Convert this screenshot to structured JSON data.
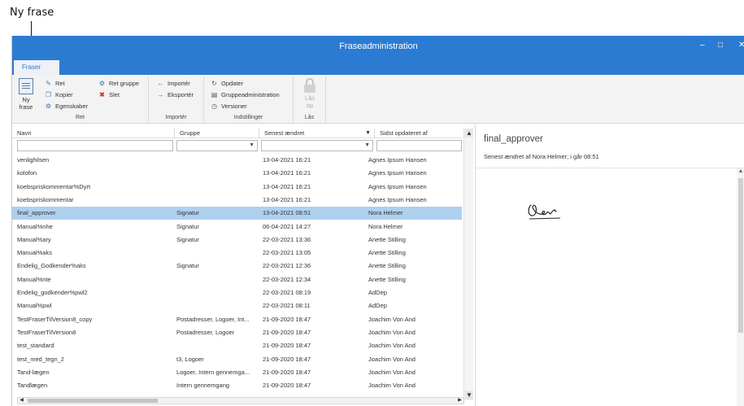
{
  "callout": {
    "label": "Ny frase"
  },
  "window": {
    "title": "Fraseadministration",
    "minimize": "–",
    "maximize": "□",
    "close": "✕"
  },
  "ribbon": {
    "tab": "Fraser",
    "groups": {
      "ret": {
        "label": "Ret",
        "ny_frase": "Ny\nfrase",
        "ret": "Ret",
        "kopier": "Kopier",
        "egenskaber": "Egenskaber",
        "ret_gruppe": "Ret gruppe",
        "slet": "Slet"
      },
      "importer": {
        "label": "Importér",
        "importer": "Importér",
        "eksporter": "Eksportér"
      },
      "indstillinger": {
        "label": "Indstillinger",
        "opdater": "Opdater",
        "gruppeadministration": "Gruppeadministration",
        "versioner": "Versioner"
      },
      "laas": {
        "label": "Lås",
        "laas_op": "Lås\nop"
      }
    }
  },
  "grid": {
    "columns": {
      "navn": "Navn",
      "gruppe": "Gruppe",
      "senest": "Senest ændret",
      "sidst": "Sidst opdateret af"
    },
    "rows": [
      {
        "navn": "venlighilsen",
        "gruppe": "",
        "senest": "13-04-2021 16:21",
        "sidst": "Agnes Ipsum Hansen"
      },
      {
        "navn": "kolofon",
        "gruppe": "",
        "senest": "13-04-2021 16:21",
        "sidst": "Agnes Ipsum Hansen"
      },
      {
        "navn": "koebspriskommentar%Dyrt",
        "gruppe": "",
        "senest": "13-04-2021 16:21",
        "sidst": "Agnes Ipsum Hansen"
      },
      {
        "navn": "koebspriskommentar",
        "gruppe": "",
        "senest": "13-04-2021 16:21",
        "sidst": "Agnes Ipsum Hansen"
      },
      {
        "navn": "final_approver",
        "gruppe": "Signatur",
        "senest": "13-04-2021 08:51",
        "sidst": "Nora Helmer",
        "selected": true
      },
      {
        "navn": "Manual%nhe",
        "gruppe": "Signatur",
        "senest": "06-04-2021 14:27",
        "sidst": "Nora Helmer"
      },
      {
        "navn": "Manual%ary",
        "gruppe": "Signatur",
        "senest": "22-03-2021 13:36",
        "sidst": "Anette Stilling"
      },
      {
        "navn": "Manual%aks",
        "gruppe": "",
        "senest": "22-03-2021 13:05",
        "sidst": "Anette Stilling"
      },
      {
        "navn": "Endelig_Godkender%aks",
        "gruppe": "Signatur",
        "senest": "22-03-2021 12:36",
        "sidst": "Anette Stilling"
      },
      {
        "navn": "Manual%nte",
        "gruppe": "",
        "senest": "22-03-2021 12:34",
        "sidst": "Anette Stilling"
      },
      {
        "navn": "Endelig_godkender%pwl2",
        "gruppe": "",
        "senest": "22-03-2021 08:19",
        "sidst": "AdDep"
      },
      {
        "navn": "Manual%pwl",
        "gruppe": "",
        "senest": "22-03-2021 08:11",
        "sidst": "AdDep"
      },
      {
        "navn": "TestFraserTilVersion8_copy",
        "gruppe": "Postadresser, Logoer, Int...",
        "senest": "21-09-2020 18:47",
        "sidst": "Joachim Von And"
      },
      {
        "navn": "TestFraserTilVersion8",
        "gruppe": "Postadresser, Logoer",
        "senest": "21-09-2020 18:47",
        "sidst": "Joachim Von And"
      },
      {
        "navn": "test_standard",
        "gruppe": "",
        "senest": "21-09-2020 18:47",
        "sidst": "Joachim Von And"
      },
      {
        "navn": "test_med_tegn_2",
        "gruppe": "t3, Logoer",
        "senest": "21-09-2020 18:47",
        "sidst": "Joachim Von And"
      },
      {
        "navn": "Tand-lægen",
        "gruppe": "Logoer, Intern gennemga...",
        "senest": "21-09-2020 18:47",
        "sidst": "Joachim Von And"
      },
      {
        "navn": "Tandlægen",
        "gruppe": "Intern gennemgang",
        "senest": "21-09-2020 18:47",
        "sidst": "Joachim Von And"
      }
    ]
  },
  "preview": {
    "title": "final_approver",
    "subtitle": "Senest ændret af Nora Helmer; i går 08:51"
  }
}
